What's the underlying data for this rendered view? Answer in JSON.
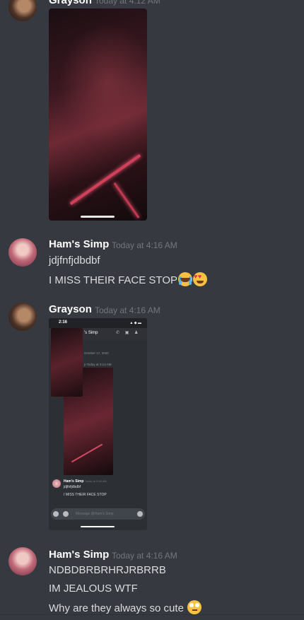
{
  "messages": [
    {
      "author": "Grayson",
      "timestamp": "Today at 4:12 AM",
      "attachment": "image"
    },
    {
      "author": "Ham's Simp",
      "timestamp": "Today at 4:16 AM",
      "lines": [
        "jdjfnfjdbdbf",
        "I MISS THEIR FACE STOP"
      ],
      "emojis": [
        "loudly-crying-face",
        "heart-eyes-face"
      ]
    },
    {
      "author": "Grayson",
      "timestamp": "Today at 4:16 AM",
      "attachment": "screenshot",
      "screenshot": {
        "clock": "2:16",
        "header_name": "'s Simp",
        "date_divider": "October 17, 2020",
        "inner_timestamp": "p  Today at 3:12 AM",
        "inner_author": "Ham's Simp",
        "inner_author_time": "Today at 2:16 AM",
        "inner_line1": "jdjfnfjdbdbf",
        "inner_line2": "I MISS THEIR FACE STOP",
        "composer_placeholder": "Message @Ham's Simp"
      }
    },
    {
      "author": "Ham's Simp",
      "timestamp": "Today at 4:16 AM",
      "lines": [
        "NDBDBRBRHRJRBRRB",
        "IM JEALOUS WTF",
        "Why are they always so cute"
      ],
      "emojis": [
        "face-with-rolling-eyes"
      ]
    }
  ],
  "colors": {
    "background": "#36393f",
    "username": "#ffffff",
    "timestamp": "#72767d",
    "text": "#dcddde"
  }
}
